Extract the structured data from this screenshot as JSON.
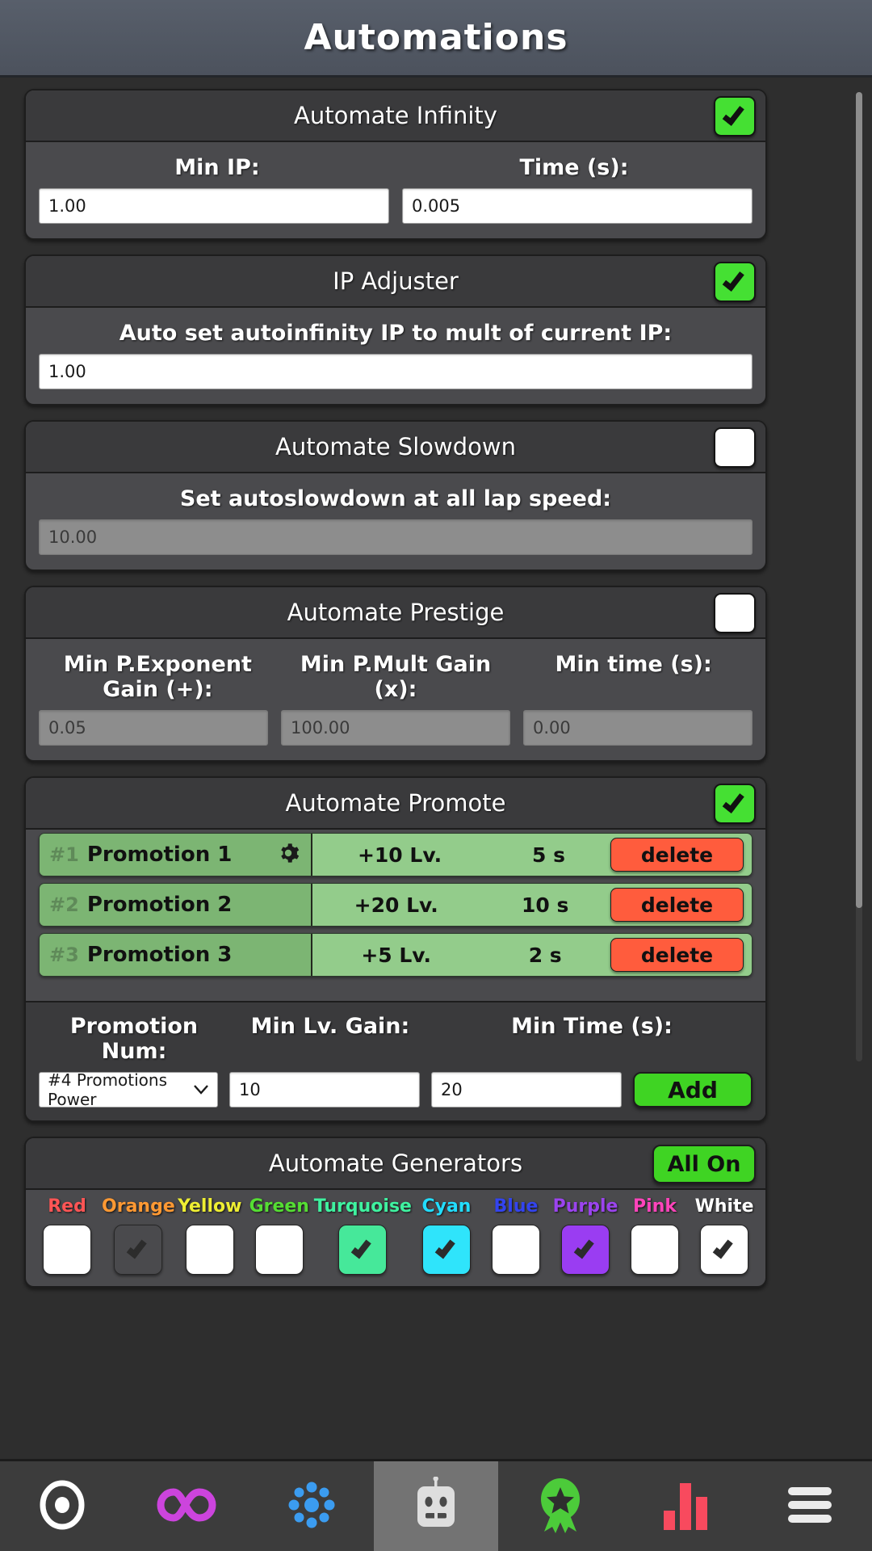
{
  "header": {
    "title": "Automations"
  },
  "sections": {
    "infinity": {
      "title": "Automate Infinity",
      "toggle_state": "on",
      "fields": [
        {
          "label": "Min IP:",
          "value": "1.00"
        },
        {
          "label": "Time (s):",
          "value": "0.005"
        }
      ]
    },
    "ip_adjuster": {
      "title": "IP Adjuster",
      "toggle_state": "on",
      "fields": [
        {
          "label": "Auto set autoinfinity IP to mult of current IP:",
          "value": "1.00"
        }
      ]
    },
    "slowdown": {
      "title": "Automate Slowdown",
      "toggle_state": "off",
      "fields": [
        {
          "label": "Set autoslowdown at all lap speed:",
          "value": "10.00"
        }
      ]
    },
    "prestige": {
      "title": "Automate Prestige",
      "toggle_state": "off",
      "fields": [
        {
          "label": "Min P.Exponent Gain (+):",
          "value": "0.05"
        },
        {
          "label": "Min P.Mult Gain (x):",
          "value": "100.00"
        },
        {
          "label": "Min time (s):",
          "value": "0.00"
        }
      ]
    },
    "promote": {
      "title": "Automate Promote",
      "toggle_state": "on",
      "rows": [
        {
          "num": "#1",
          "name": "Promotion 1",
          "gain": "+10 Lv.",
          "time": "5 s",
          "delete_label": "delete",
          "gear": "gear-icon"
        },
        {
          "num": "#2",
          "name": "Promotion 2",
          "gain": "+20 Lv.",
          "time": "10 s",
          "delete_label": "delete"
        },
        {
          "num": "#3",
          "name": "Promotion 3",
          "gain": "+5 Lv.",
          "time": "2 s",
          "delete_label": "delete"
        }
      ],
      "form": {
        "labels": [
          "Promotion Num:",
          "Min Lv. Gain:",
          "Min Time (s):"
        ],
        "select_value": "#4 Promotions Power",
        "min_lv_gain": "10",
        "min_time": "20",
        "add_label": "Add"
      }
    },
    "generators": {
      "title": "Automate Generators",
      "all_on_label": "All On",
      "items": [
        {
          "label": "Red",
          "color": "#ff5555",
          "checked": false,
          "box_color": "#ffffff"
        },
        {
          "label": "Orange",
          "color": "#ff9933",
          "checked": true,
          "box_color": "#f5a council"
        },
        {
          "label": "Yellow",
          "color": "#eeee33",
          "checked": false,
          "box_color": "#ffffff"
        },
        {
          "label": "Green",
          "color": "#55dd33",
          "checked": false,
          "box_color": "#ffffff"
        },
        {
          "label": "Turquoise",
          "color": "#3ff2a0",
          "checked": true,
          "box_color": "#46e89a"
        },
        {
          "label": "Cyan",
          "color": "#22ddff",
          "checked": true,
          "box_color": "#2fe4fb"
        },
        {
          "label": "Blue",
          "color": "#3344ee",
          "checked": false,
          "box_color": "#ffffff"
        },
        {
          "label": "Purple",
          "color": "#9b44ee",
          "checked": true,
          "box_color": "#9a3df2"
        },
        {
          "label": "Pink",
          "color": "#ff44bb",
          "checked": false,
          "box_color": "#ffffff"
        },
        {
          "label": "White",
          "color": "#ffffff",
          "checked": true,
          "box_color": "#ffffff"
        }
      ]
    }
  },
  "navbar": {
    "items": [
      {
        "icon": "antimatter-ring-icon",
        "active": false
      },
      {
        "icon": "infinity-icon",
        "active": false
      },
      {
        "icon": "atom-dots-icon",
        "active": false
      },
      {
        "icon": "robot-icon",
        "active": true
      },
      {
        "icon": "award-star-icon",
        "active": false
      },
      {
        "icon": "bar-chart-icon",
        "active": false
      },
      {
        "icon": "hamburger-menu-icon",
        "active": false
      }
    ]
  }
}
